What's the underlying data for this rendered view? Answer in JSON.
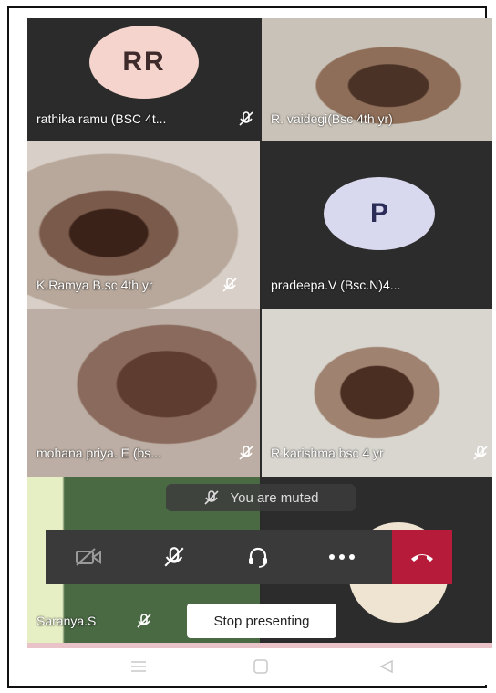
{
  "participants": [
    {
      "name": "rathika ramu (BSC 4t...",
      "initials": "RR"
    },
    {
      "name": "R. vaidegi(Bsc 4th yr)"
    },
    {
      "name": "K.Ramya B.sc 4th yr"
    },
    {
      "name": "pradeepa.V (Bsc.N)4...",
      "initials": "P"
    },
    {
      "name": "mohana priya. E (bs..."
    },
    {
      "name": "R.karishma bsc 4 yr"
    },
    {
      "name": "Saranya.S"
    }
  ],
  "toast": {
    "text": "You are muted"
  },
  "controls": {
    "camera_icon": "camera-off-icon",
    "mic_icon": "mic-off-icon",
    "audio_icon": "headset-icon",
    "more_icon": "more-icon",
    "hangup_icon": "hang-up-icon",
    "hangup_color": "#b61c3a"
  },
  "presenting": {
    "stop_label": "Stop presenting"
  },
  "navbar": {
    "icons": [
      "menu-icon",
      "home-icon",
      "back-icon"
    ]
  }
}
